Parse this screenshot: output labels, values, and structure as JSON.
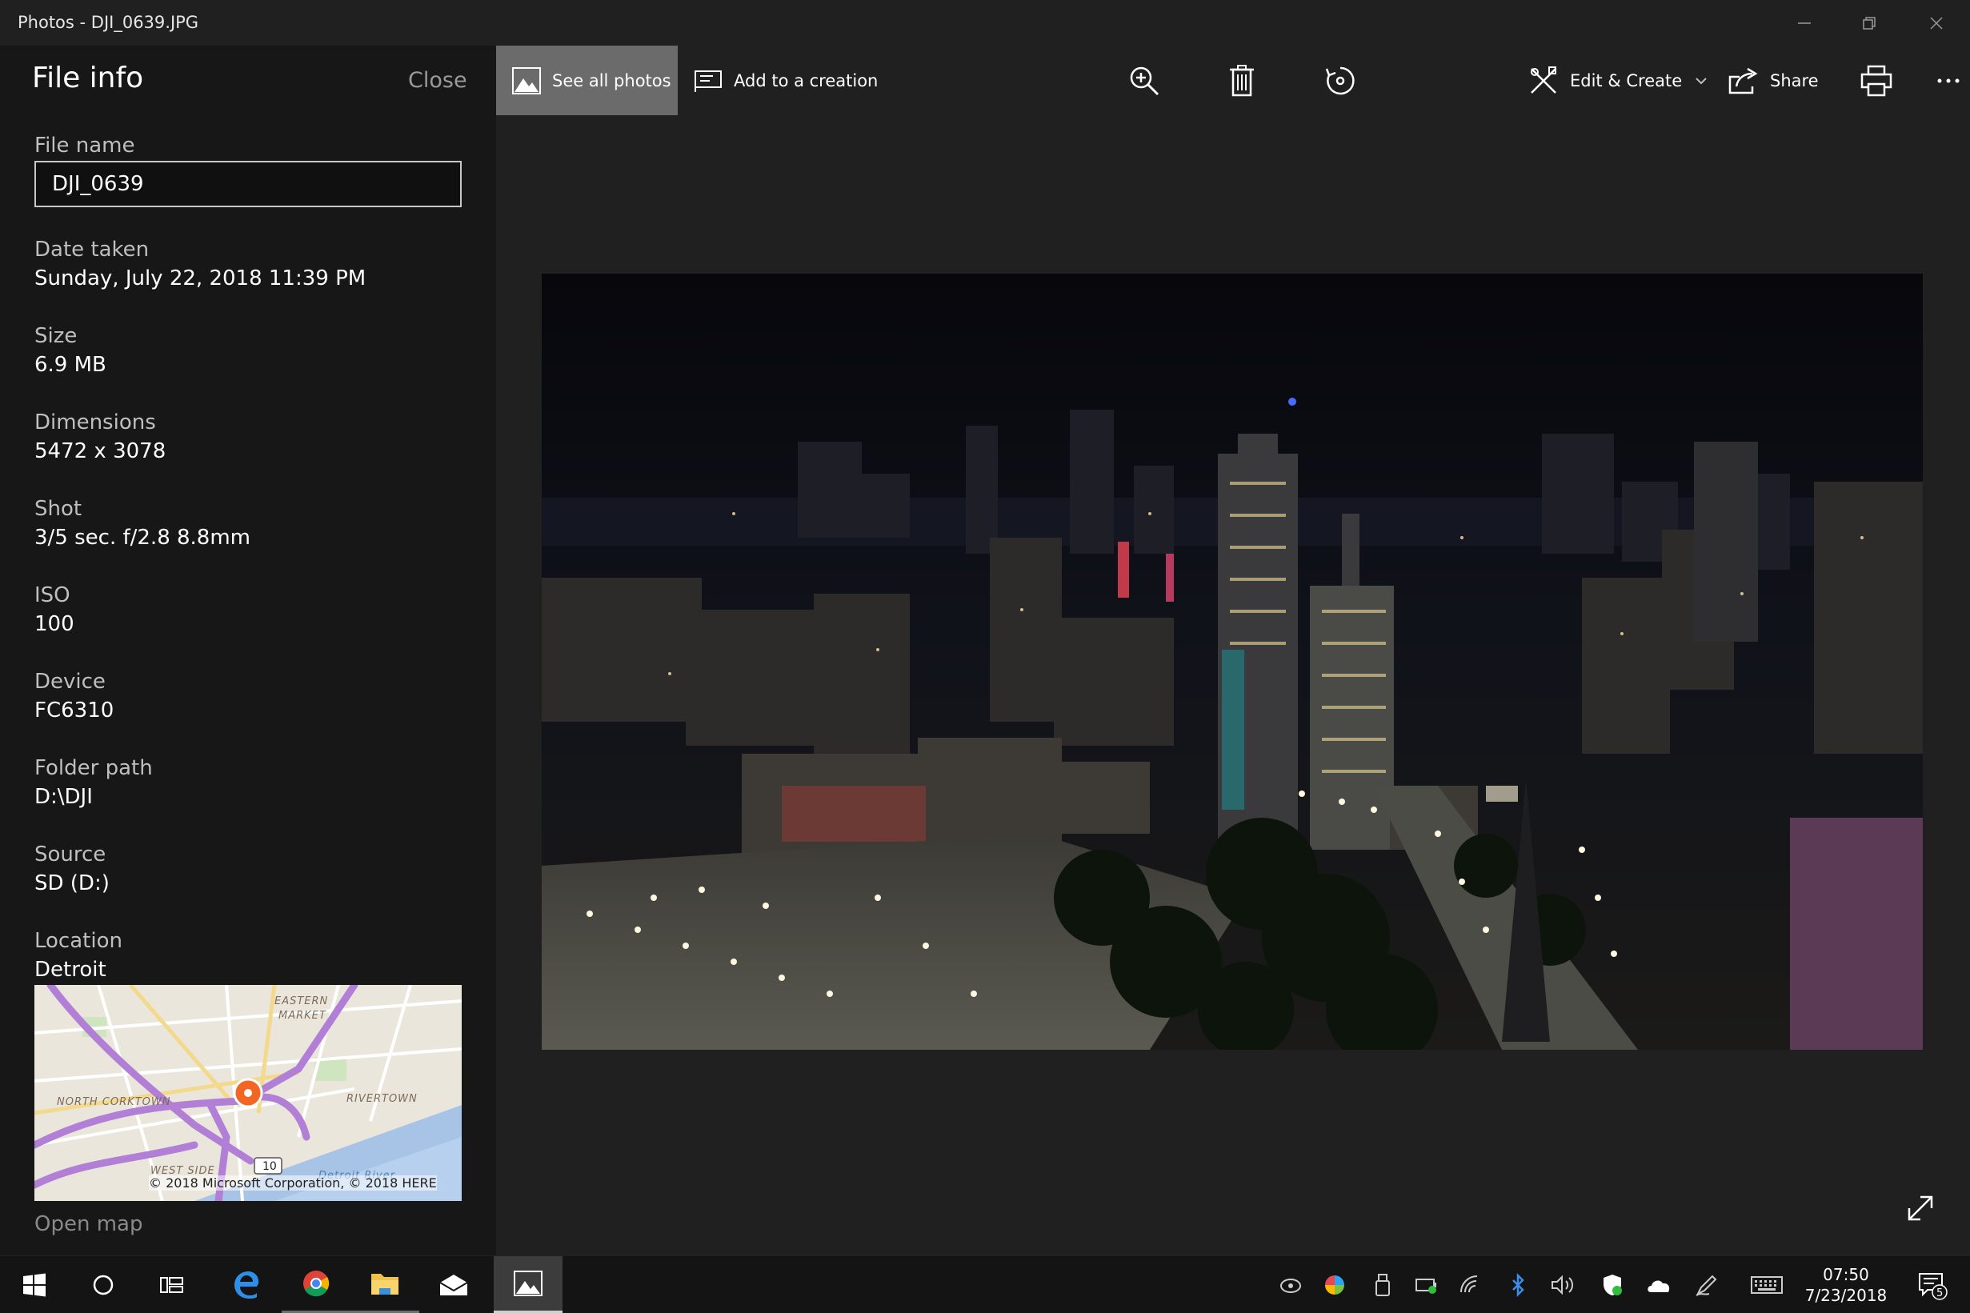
{
  "window": {
    "title": "Photos - DJI_0639.JPG"
  },
  "panel": {
    "title": "File info",
    "close_label": "Close",
    "fields": {
      "file_name_label": "File name",
      "file_name_value": "DJI_0639",
      "date_label": "Date taken",
      "date_value": "Sunday, July 22, 2018 11:39 PM",
      "size_label": "Size",
      "size_value": "6.9 MB",
      "dimensions_label": "Dimensions",
      "dimensions_value": "5472 x 3078",
      "shot_label": "Shot",
      "shot_value": "3/5 sec. f/2.8 8.8mm",
      "iso_label": "ISO",
      "iso_value": "100",
      "device_label": "Device",
      "device_value": "FC6310",
      "folder_label": "Folder path",
      "folder_value": "D:\\DJI",
      "source_label": "Source",
      "source_value": "SD (D:)",
      "location_label": "Location",
      "location_value": "Detroit"
    },
    "map": {
      "labels": [
        "EASTERN",
        "MARKET",
        "NORTH CORKTOWN",
        "RIVERTOWN",
        "WEST SIDE",
        "Detroit River"
      ],
      "road_shield": "10",
      "copyright": "© 2018 Microsoft Corporation, © 2018 HERE"
    },
    "open_map_label": "Open map"
  },
  "toolbar": {
    "see_all_label": "See all photos",
    "add_creation_label": "Add to a creation",
    "edit_create_label": "Edit & Create",
    "share_label": "Share"
  },
  "taskbar": {
    "time": "07:50",
    "date": "7/23/2018",
    "notification_count": "5"
  },
  "colors": {
    "accent_selected": "#6b6b6b",
    "panel_bg": "#171717",
    "app_bg": "#202020",
    "map_pin": "#f26522",
    "map_roads": "#b27fd6"
  }
}
